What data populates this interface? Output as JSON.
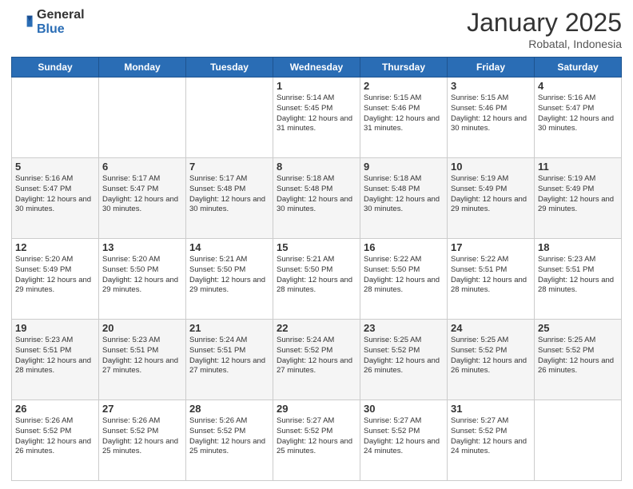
{
  "header": {
    "logo_general": "General",
    "logo_blue": "Blue",
    "month": "January 2025",
    "location": "Robatal, Indonesia"
  },
  "weekdays": [
    "Sunday",
    "Monday",
    "Tuesday",
    "Wednesday",
    "Thursday",
    "Friday",
    "Saturday"
  ],
  "weeks": [
    [
      {
        "day": "",
        "info": ""
      },
      {
        "day": "",
        "info": ""
      },
      {
        "day": "",
        "info": ""
      },
      {
        "day": "1",
        "info": "Sunrise: 5:14 AM\nSunset: 5:45 PM\nDaylight: 12 hours\nand 31 minutes."
      },
      {
        "day": "2",
        "info": "Sunrise: 5:15 AM\nSunset: 5:46 PM\nDaylight: 12 hours\nand 31 minutes."
      },
      {
        "day": "3",
        "info": "Sunrise: 5:15 AM\nSunset: 5:46 PM\nDaylight: 12 hours\nand 30 minutes."
      },
      {
        "day": "4",
        "info": "Sunrise: 5:16 AM\nSunset: 5:47 PM\nDaylight: 12 hours\nand 30 minutes."
      }
    ],
    [
      {
        "day": "5",
        "info": "Sunrise: 5:16 AM\nSunset: 5:47 PM\nDaylight: 12 hours\nand 30 minutes."
      },
      {
        "day": "6",
        "info": "Sunrise: 5:17 AM\nSunset: 5:47 PM\nDaylight: 12 hours\nand 30 minutes."
      },
      {
        "day": "7",
        "info": "Sunrise: 5:17 AM\nSunset: 5:48 PM\nDaylight: 12 hours\nand 30 minutes."
      },
      {
        "day": "8",
        "info": "Sunrise: 5:18 AM\nSunset: 5:48 PM\nDaylight: 12 hours\nand 30 minutes."
      },
      {
        "day": "9",
        "info": "Sunrise: 5:18 AM\nSunset: 5:48 PM\nDaylight: 12 hours\nand 30 minutes."
      },
      {
        "day": "10",
        "info": "Sunrise: 5:19 AM\nSunset: 5:49 PM\nDaylight: 12 hours\nand 29 minutes."
      },
      {
        "day": "11",
        "info": "Sunrise: 5:19 AM\nSunset: 5:49 PM\nDaylight: 12 hours\nand 29 minutes."
      }
    ],
    [
      {
        "day": "12",
        "info": "Sunrise: 5:20 AM\nSunset: 5:49 PM\nDaylight: 12 hours\nand 29 minutes."
      },
      {
        "day": "13",
        "info": "Sunrise: 5:20 AM\nSunset: 5:50 PM\nDaylight: 12 hours\nand 29 minutes."
      },
      {
        "day": "14",
        "info": "Sunrise: 5:21 AM\nSunset: 5:50 PM\nDaylight: 12 hours\nand 29 minutes."
      },
      {
        "day": "15",
        "info": "Sunrise: 5:21 AM\nSunset: 5:50 PM\nDaylight: 12 hours\nand 28 minutes."
      },
      {
        "day": "16",
        "info": "Sunrise: 5:22 AM\nSunset: 5:50 PM\nDaylight: 12 hours\nand 28 minutes."
      },
      {
        "day": "17",
        "info": "Sunrise: 5:22 AM\nSunset: 5:51 PM\nDaylight: 12 hours\nand 28 minutes."
      },
      {
        "day": "18",
        "info": "Sunrise: 5:23 AM\nSunset: 5:51 PM\nDaylight: 12 hours\nand 28 minutes."
      }
    ],
    [
      {
        "day": "19",
        "info": "Sunrise: 5:23 AM\nSunset: 5:51 PM\nDaylight: 12 hours\nand 28 minutes."
      },
      {
        "day": "20",
        "info": "Sunrise: 5:23 AM\nSunset: 5:51 PM\nDaylight: 12 hours\nand 27 minutes."
      },
      {
        "day": "21",
        "info": "Sunrise: 5:24 AM\nSunset: 5:51 PM\nDaylight: 12 hours\nand 27 minutes."
      },
      {
        "day": "22",
        "info": "Sunrise: 5:24 AM\nSunset: 5:52 PM\nDaylight: 12 hours\nand 27 minutes."
      },
      {
        "day": "23",
        "info": "Sunrise: 5:25 AM\nSunset: 5:52 PM\nDaylight: 12 hours\nand 26 minutes."
      },
      {
        "day": "24",
        "info": "Sunrise: 5:25 AM\nSunset: 5:52 PM\nDaylight: 12 hours\nand 26 minutes."
      },
      {
        "day": "25",
        "info": "Sunrise: 5:25 AM\nSunset: 5:52 PM\nDaylight: 12 hours\nand 26 minutes."
      }
    ],
    [
      {
        "day": "26",
        "info": "Sunrise: 5:26 AM\nSunset: 5:52 PM\nDaylight: 12 hours\nand 26 minutes."
      },
      {
        "day": "27",
        "info": "Sunrise: 5:26 AM\nSunset: 5:52 PM\nDaylight: 12 hours\nand 25 minutes."
      },
      {
        "day": "28",
        "info": "Sunrise: 5:26 AM\nSunset: 5:52 PM\nDaylight: 12 hours\nand 25 minutes."
      },
      {
        "day": "29",
        "info": "Sunrise: 5:27 AM\nSunset: 5:52 PM\nDaylight: 12 hours\nand 25 minutes."
      },
      {
        "day": "30",
        "info": "Sunrise: 5:27 AM\nSunset: 5:52 PM\nDaylight: 12 hours\nand 24 minutes."
      },
      {
        "day": "31",
        "info": "Sunrise: 5:27 AM\nSunset: 5:52 PM\nDaylight: 12 hours\nand 24 minutes."
      },
      {
        "day": "",
        "info": ""
      }
    ]
  ]
}
